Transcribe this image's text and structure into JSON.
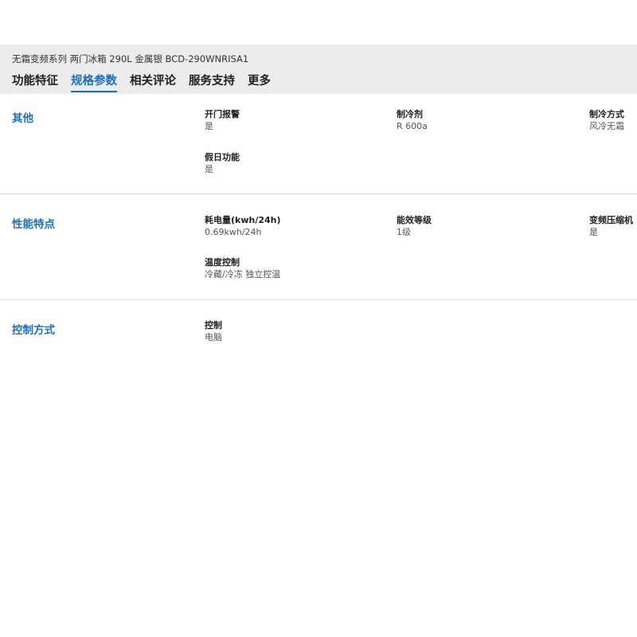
{
  "header": {
    "product_title": "无霜变频系列 两门冰箱 290L 金属银 BCD-290WNRISA1",
    "tabs": [
      {
        "label": "功能特征",
        "active": false
      },
      {
        "label": "规格参数",
        "active": true
      },
      {
        "label": "相关评论",
        "active": false
      },
      {
        "label": "服务支持",
        "active": false
      },
      {
        "label": "更多",
        "active": false
      }
    ]
  },
  "sections": [
    {
      "title": "其他",
      "specs": [
        {
          "name": "开门报警",
          "value": "是"
        },
        {
          "name": "制冷剂",
          "value": "R 600a"
        },
        {
          "name": "制冷方式",
          "value": "风冷无霜"
        },
        {
          "name": "假日功能",
          "value": "是"
        }
      ]
    },
    {
      "title": "性能特点",
      "specs": [
        {
          "name": "耗电量(kwh/24h)",
          "value": "0.69kwh/24h"
        },
        {
          "name": "能效等级",
          "value": "1级"
        },
        {
          "name": "变频压缩机",
          "value": "是"
        },
        {
          "name": "温度控制",
          "value": "冷藏/冷冻 独立控温"
        }
      ]
    },
    {
      "title": "控制方式",
      "specs": [
        {
          "name": "控制",
          "value": "电脑"
        }
      ]
    }
  ],
  "colors": {
    "accent": "#1e6fb8",
    "header_bg": "#ececec",
    "divider": "#dcdcdc"
  }
}
